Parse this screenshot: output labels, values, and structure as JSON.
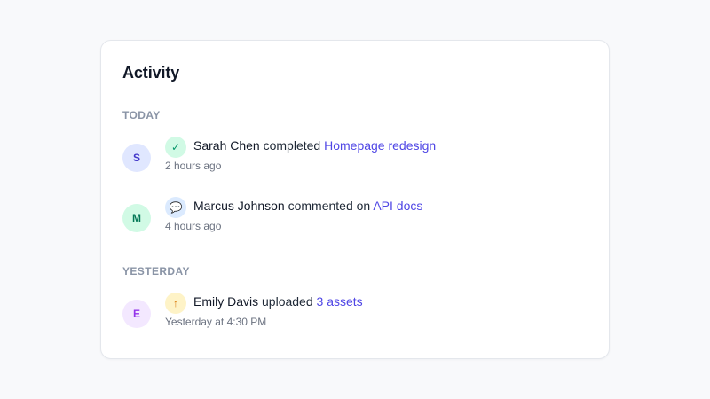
{
  "card": {
    "title": "Activity"
  },
  "groups": [
    {
      "label": "TODAY",
      "items": [
        {
          "initial": "S",
          "actor": "Sarah Chen",
          "verb": "completed",
          "target": "Homepage redesign",
          "time": "2 hours ago",
          "icon": "check-icon",
          "icon_glyph": "✓",
          "avatar_bg": "#e0e7ff",
          "avatar_fg": "#4338ca",
          "badge_bg": "#d1fae5",
          "badge_fg": "#059669"
        },
        {
          "initial": "M",
          "actor": "Marcus Johnson",
          "verb": "commented on",
          "target": "API docs",
          "time": "4 hours ago",
          "icon": "comment-icon",
          "icon_glyph": "💬",
          "avatar_bg": "#d1fae5",
          "avatar_fg": "#047857",
          "badge_bg": "#dbeafe",
          "badge_fg": "#2563eb"
        }
      ]
    },
    {
      "label": "YESTERDAY",
      "items": [
        {
          "initial": "E",
          "actor": "Emily Davis",
          "verb": "uploaded",
          "target": "3 assets",
          "time": "Yesterday at 4:30 PM",
          "icon": "upload-icon",
          "icon_glyph": "↑",
          "avatar_bg": "#f3e8ff",
          "avatar_fg": "#9333ea",
          "badge_bg": "#fef3c7",
          "badge_fg": "#d97706"
        }
      ]
    }
  ]
}
